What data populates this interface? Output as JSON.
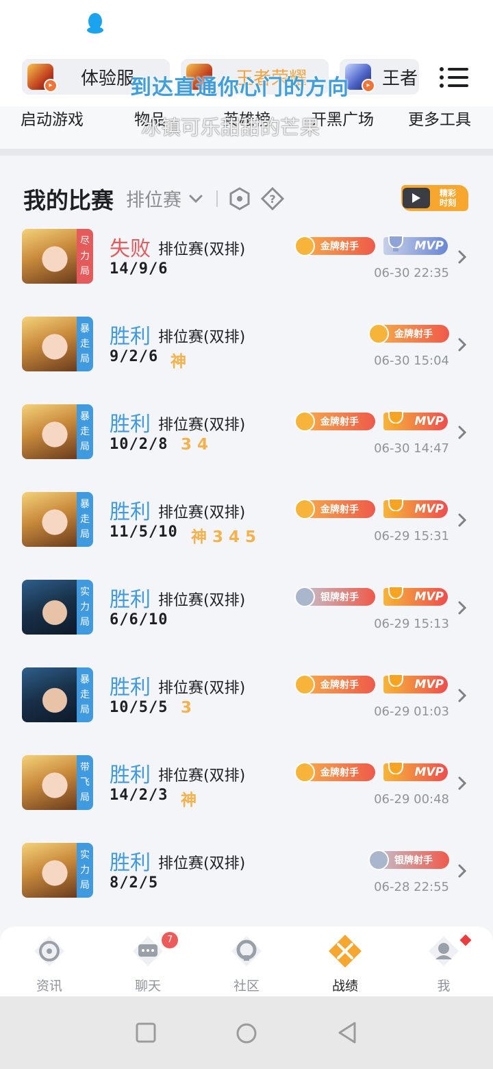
{
  "top": {
    "servers": [
      {
        "label": "体验服"
      },
      {
        "label": "王者荣耀"
      },
      {
        "label": "王者"
      }
    ],
    "overlay_text_1": "到达直通你心门的方向",
    "tools": [
      "启动游戏",
      "物品",
      "英雄榜",
      "开黑广场",
      "更多工具"
    ],
    "overlay_text_2": "冰镇可乐甜甜的芒果"
  },
  "section": {
    "title": "我的比赛",
    "filter_label": "排位赛",
    "highlight_label_1": "精彩",
    "highlight_label_2": "时刻"
  },
  "matches": [
    {
      "tag": [
        "尽",
        "力",
        "局"
      ],
      "tag_color": "red",
      "result": "失败",
      "result_type": "lose",
      "mode": "排位赛(双排)",
      "kda": "14/9/6",
      "extras": "",
      "badge": "金牌射手",
      "badge_type": "gold",
      "mvp": "MVP",
      "mvp_type": "silver",
      "time": "06-30 22:35",
      "avatar": "female"
    },
    {
      "tag": [
        "暴",
        "走",
        "局"
      ],
      "tag_color": "blue",
      "result": "胜利",
      "result_type": "win",
      "mode": "排位赛(双排)",
      "kda": "9/2/6",
      "extras": "神",
      "badge": "金牌射手",
      "badge_type": "gold",
      "mvp": "",
      "mvp_type": "",
      "time": "06-30 15:04",
      "avatar": "female"
    },
    {
      "tag": [
        "暴",
        "走",
        "局"
      ],
      "tag_color": "blue",
      "result": "胜利",
      "result_type": "win",
      "mode": "排位赛(双排)",
      "kda": "10/2/8",
      "extras": "3 4",
      "badge": "金牌射手",
      "badge_type": "gold",
      "mvp": "MVP",
      "mvp_type": "gold",
      "time": "06-30 14:47",
      "avatar": "female"
    },
    {
      "tag": [
        "暴",
        "走",
        "局"
      ],
      "tag_color": "blue",
      "result": "胜利",
      "result_type": "win",
      "mode": "排位赛(双排)",
      "kda": "11/5/10",
      "extras": "神 3 4 5",
      "badge": "金牌射手",
      "badge_type": "gold",
      "mvp": "MVP",
      "mvp_type": "gold",
      "time": "06-29 15:31",
      "avatar": "female"
    },
    {
      "tag": [
        "实",
        "力",
        "局"
      ],
      "tag_color": "blue",
      "result": "胜利",
      "result_type": "win",
      "mode": "排位赛(双排)",
      "kda": "6/6/10",
      "extras": "",
      "badge": "银牌射手",
      "badge_type": "silver",
      "mvp": "MVP",
      "mvp_type": "gold",
      "time": "06-29 15:13",
      "avatar": "male"
    },
    {
      "tag": [
        "暴",
        "走",
        "局"
      ],
      "tag_color": "blue",
      "result": "胜利",
      "result_type": "win",
      "mode": "排位赛(双排)",
      "kda": "10/5/5",
      "extras": "3",
      "badge": "金牌射手",
      "badge_type": "gold",
      "mvp": "MVP",
      "mvp_type": "gold",
      "time": "06-29 01:03",
      "avatar": "male"
    },
    {
      "tag": [
        "带",
        "飞",
        "局"
      ],
      "tag_color": "blue",
      "result": "胜利",
      "result_type": "win",
      "mode": "排位赛(双排)",
      "kda": "14/2/3",
      "extras": "神",
      "badge": "金牌射手",
      "badge_type": "gold",
      "mvp": "MVP",
      "mvp_type": "gold",
      "time": "06-29 00:48",
      "avatar": "female"
    },
    {
      "tag": [
        "实",
        "力",
        "局"
      ],
      "tag_color": "blue",
      "result": "胜利",
      "result_type": "win",
      "mode": "排位赛(双排)",
      "kda": "8/2/5",
      "extras": "",
      "badge": "银牌射手",
      "badge_type": "silver",
      "mvp": "",
      "mvp_type": "",
      "time": "06-28 22:55",
      "avatar": "female"
    }
  ],
  "bottom_nav": {
    "items": [
      {
        "label": "资讯",
        "icon": "compass-icon"
      },
      {
        "label": "聊天",
        "icon": "chat-icon"
      },
      {
        "label": "社区",
        "icon": "community-icon"
      },
      {
        "label": "战绩",
        "icon": "swords-icon"
      },
      {
        "label": "我",
        "icon": "profile-icon"
      }
    ],
    "chat_badge": "7",
    "active": "战绩"
  },
  "colors": {
    "win": "#3f9ae0",
    "lose": "#e55a5a",
    "accent": "#f7a72e"
  }
}
